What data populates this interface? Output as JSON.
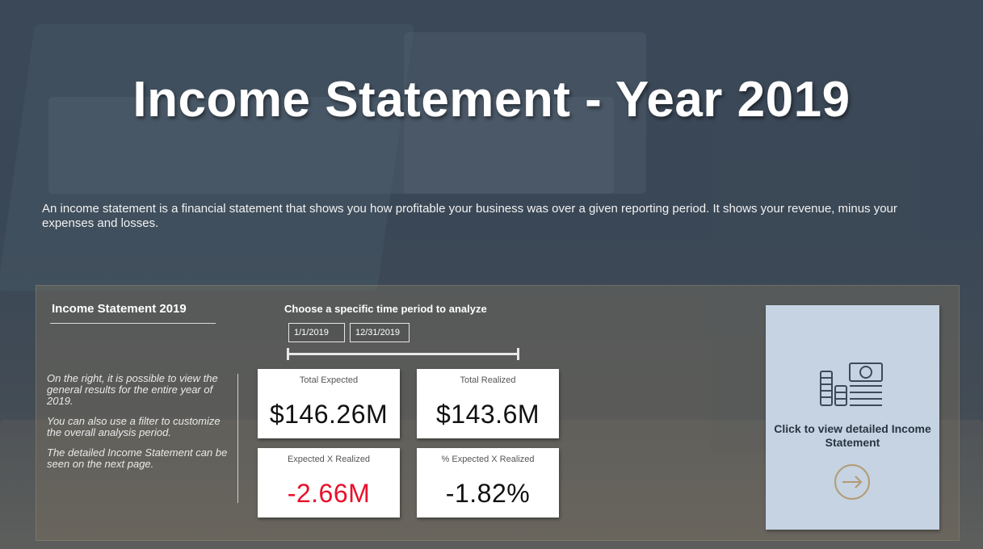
{
  "title": "Income Statement - Year 2019",
  "description": "An income statement is a financial statement that shows you how profitable your business was over a given reporting period. It shows your revenue, minus your expenses and losses.",
  "panel": {
    "title": "Income Statement 2019",
    "notes": [
      "On the right, it is possible to view the general results for the entire year of 2019.",
      "You can also use a filter to customize the overall analysis period.",
      "The detailed Income Statement can be seen on the next page."
    ]
  },
  "filter": {
    "label": "Choose a specific time period to analyze",
    "start_date": "1/1/2019",
    "end_date": "12/31/2019"
  },
  "kpis": [
    {
      "label": "Total Expected",
      "value": "$146.26M"
    },
    {
      "label": "Total Realized",
      "value": "$143.6M"
    },
    {
      "label": "Expected X Realized",
      "value": "-2.66M"
    },
    {
      "label": "% Expected X Realized",
      "value": "-1.82%"
    }
  ],
  "nav": {
    "text": "Click to view detailed Income Statement",
    "icon": "money-stack-icon",
    "arrow_icon": "arrow-right-circle-icon",
    "accent_color": "#b39a72"
  },
  "colors": {
    "negative": "#e8102a",
    "nav_bg": "#c5d3e2"
  }
}
